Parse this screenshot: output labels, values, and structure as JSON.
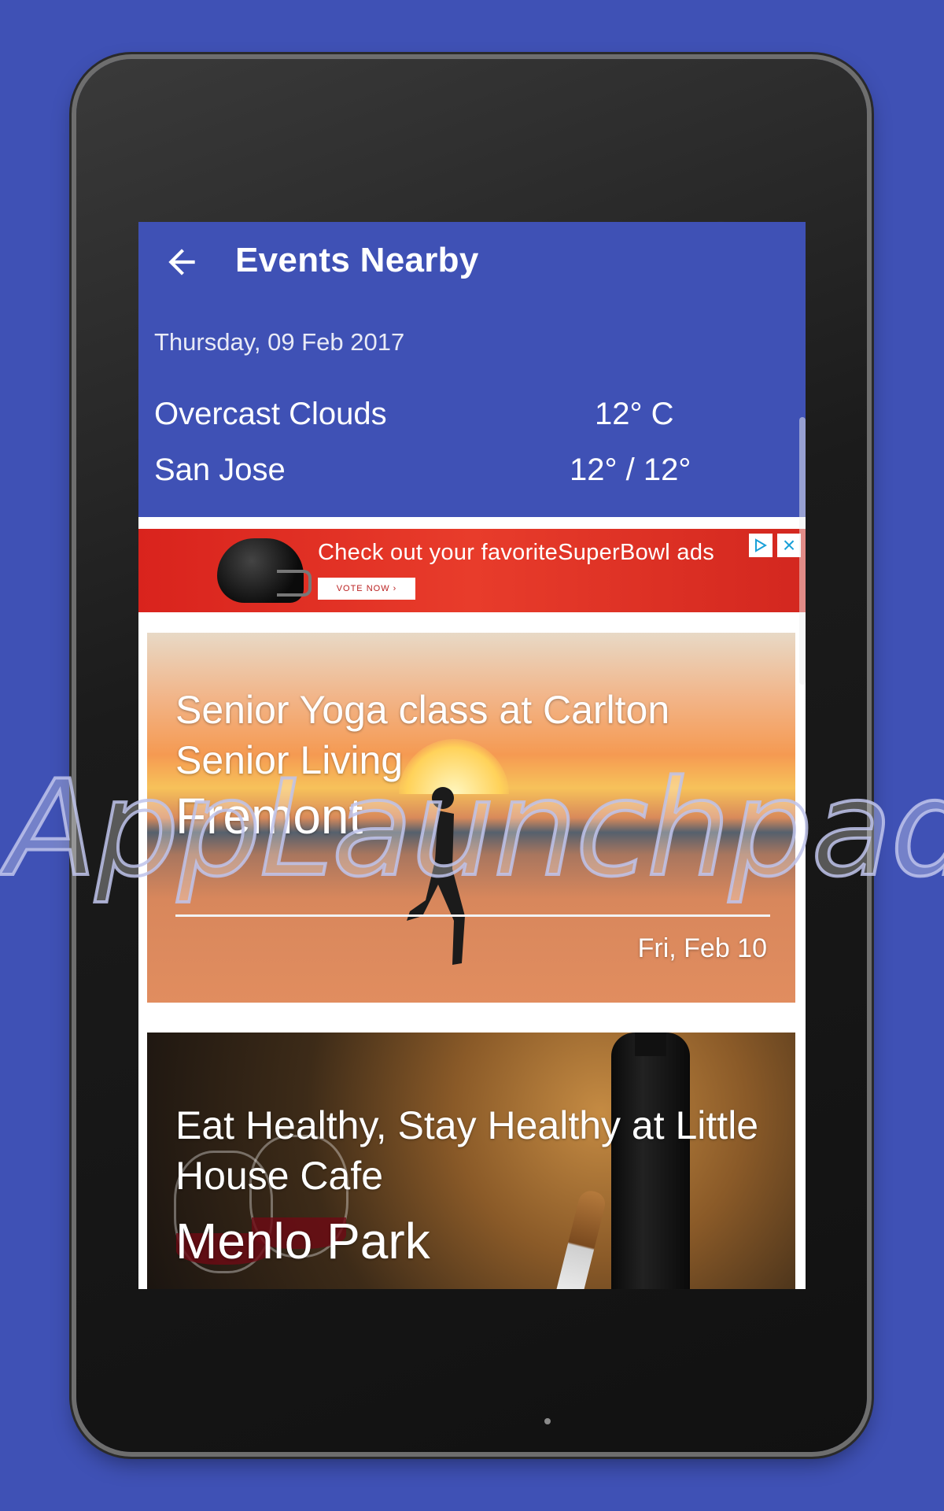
{
  "app": {
    "title": "Events Nearby",
    "back_icon": "arrow-left-icon"
  },
  "weather": {
    "date": "Thursday, 09 Feb 2017",
    "condition": "Overcast Clouds",
    "temperature": "12° C",
    "city": "San Jose",
    "range": "12° / 12°"
  },
  "ad": {
    "text": "Check out your favoriteSuperBowl ads",
    "button_label": "VOTE NOW ›",
    "close_icon": "close-icon",
    "adchoices_icon": "adchoices-icon",
    "colors": {
      "background": "#e0291f"
    }
  },
  "events": [
    {
      "title": "Senior Yoga class at Carlton Senior Living",
      "city": "Fremont",
      "date": "Fri, Feb 10"
    },
    {
      "title": "Eat Healthy, Stay Healthy at Little House Cafe",
      "city": "Menlo Park"
    }
  ],
  "watermark": "AppLaunchpad",
  "colors": {
    "primary": "#3f51b5",
    "background": "#3f51b5"
  }
}
